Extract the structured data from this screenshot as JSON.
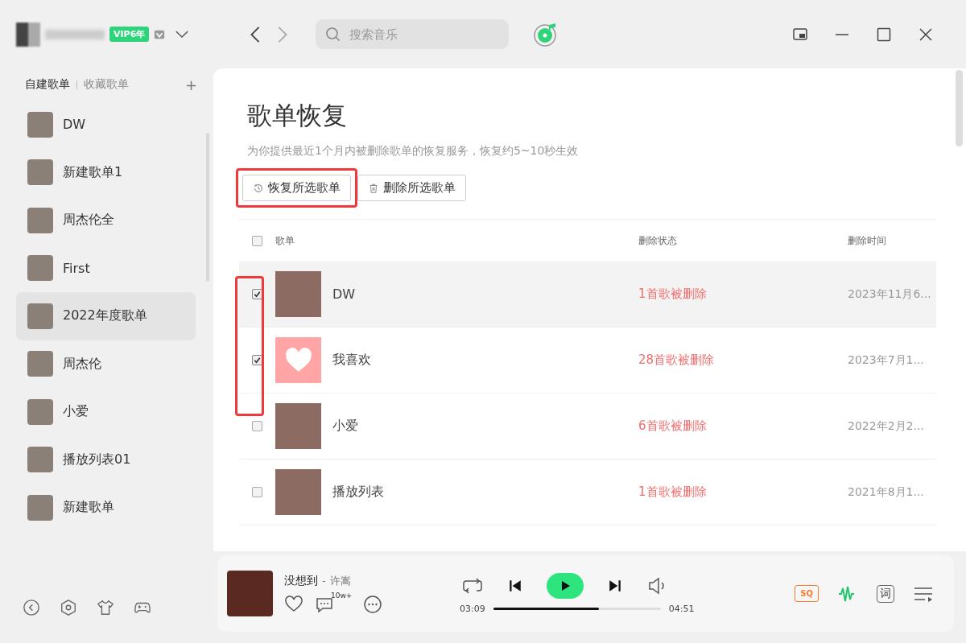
{
  "user": {
    "vip_badge": "VIP6年"
  },
  "search": {
    "placeholder": "搜索音乐"
  },
  "sidebar": {
    "tabs": [
      {
        "label": "自建歌单",
        "selected": true
      },
      {
        "label": "收藏歌单",
        "selected": false
      }
    ],
    "add_button": "+",
    "items": [
      {
        "label": "DW",
        "selected": false
      },
      {
        "label": "新建歌单1",
        "selected": false
      },
      {
        "label": "周杰伦全",
        "selected": false
      },
      {
        "label": "First",
        "selected": false
      },
      {
        "label": "2022年度歌单",
        "selected": true
      },
      {
        "label": "周杰伦",
        "selected": false
      },
      {
        "label": "小爱",
        "selected": false
      },
      {
        "label": "播放列表01",
        "selected": false
      },
      {
        "label": "新建歌单",
        "selected": false
      }
    ]
  },
  "page": {
    "title": "歌单恢复",
    "subtitle": "为你提供最近1个月内被删除歌单的恢复服务，恢复约5~10秒生效",
    "buttons": [
      {
        "label": "恢复所选歌单",
        "kind": "restore",
        "highlighted": true
      },
      {
        "label": "删除所选歌单",
        "kind": "delete",
        "highlighted": false
      }
    ],
    "table": {
      "select_all": false,
      "columns": [
        "歌单",
        "删除状态",
        "删除时间"
      ],
      "rows": [
        {
          "name": "DW",
          "status": "1首歌被删除",
          "time": "2023年11月6...",
          "checked": true,
          "hovered": true,
          "kind": "photo"
        },
        {
          "name": "我喜欢",
          "status": "28首歌被删除",
          "time": "2023年7月1...",
          "checked": true,
          "hovered": false,
          "kind": "heart"
        },
        {
          "name": "小爱",
          "status": "6首歌被删除",
          "time": "2022年2月2...",
          "checked": false,
          "hovered": false,
          "kind": "photo"
        },
        {
          "name": "播放列表",
          "status": "1首歌被删除",
          "time": "2021年8月1...",
          "checked": false,
          "hovered": false,
          "kind": "photo"
        }
      ]
    }
  },
  "player": {
    "song": "没想到",
    "separator": "-",
    "artist": "许嵩",
    "comment_count": "10w+",
    "elapsed": "03:09",
    "duration": "04:51",
    "level": 0.63,
    "quality": "SQ",
    "lyrics": "词"
  }
}
